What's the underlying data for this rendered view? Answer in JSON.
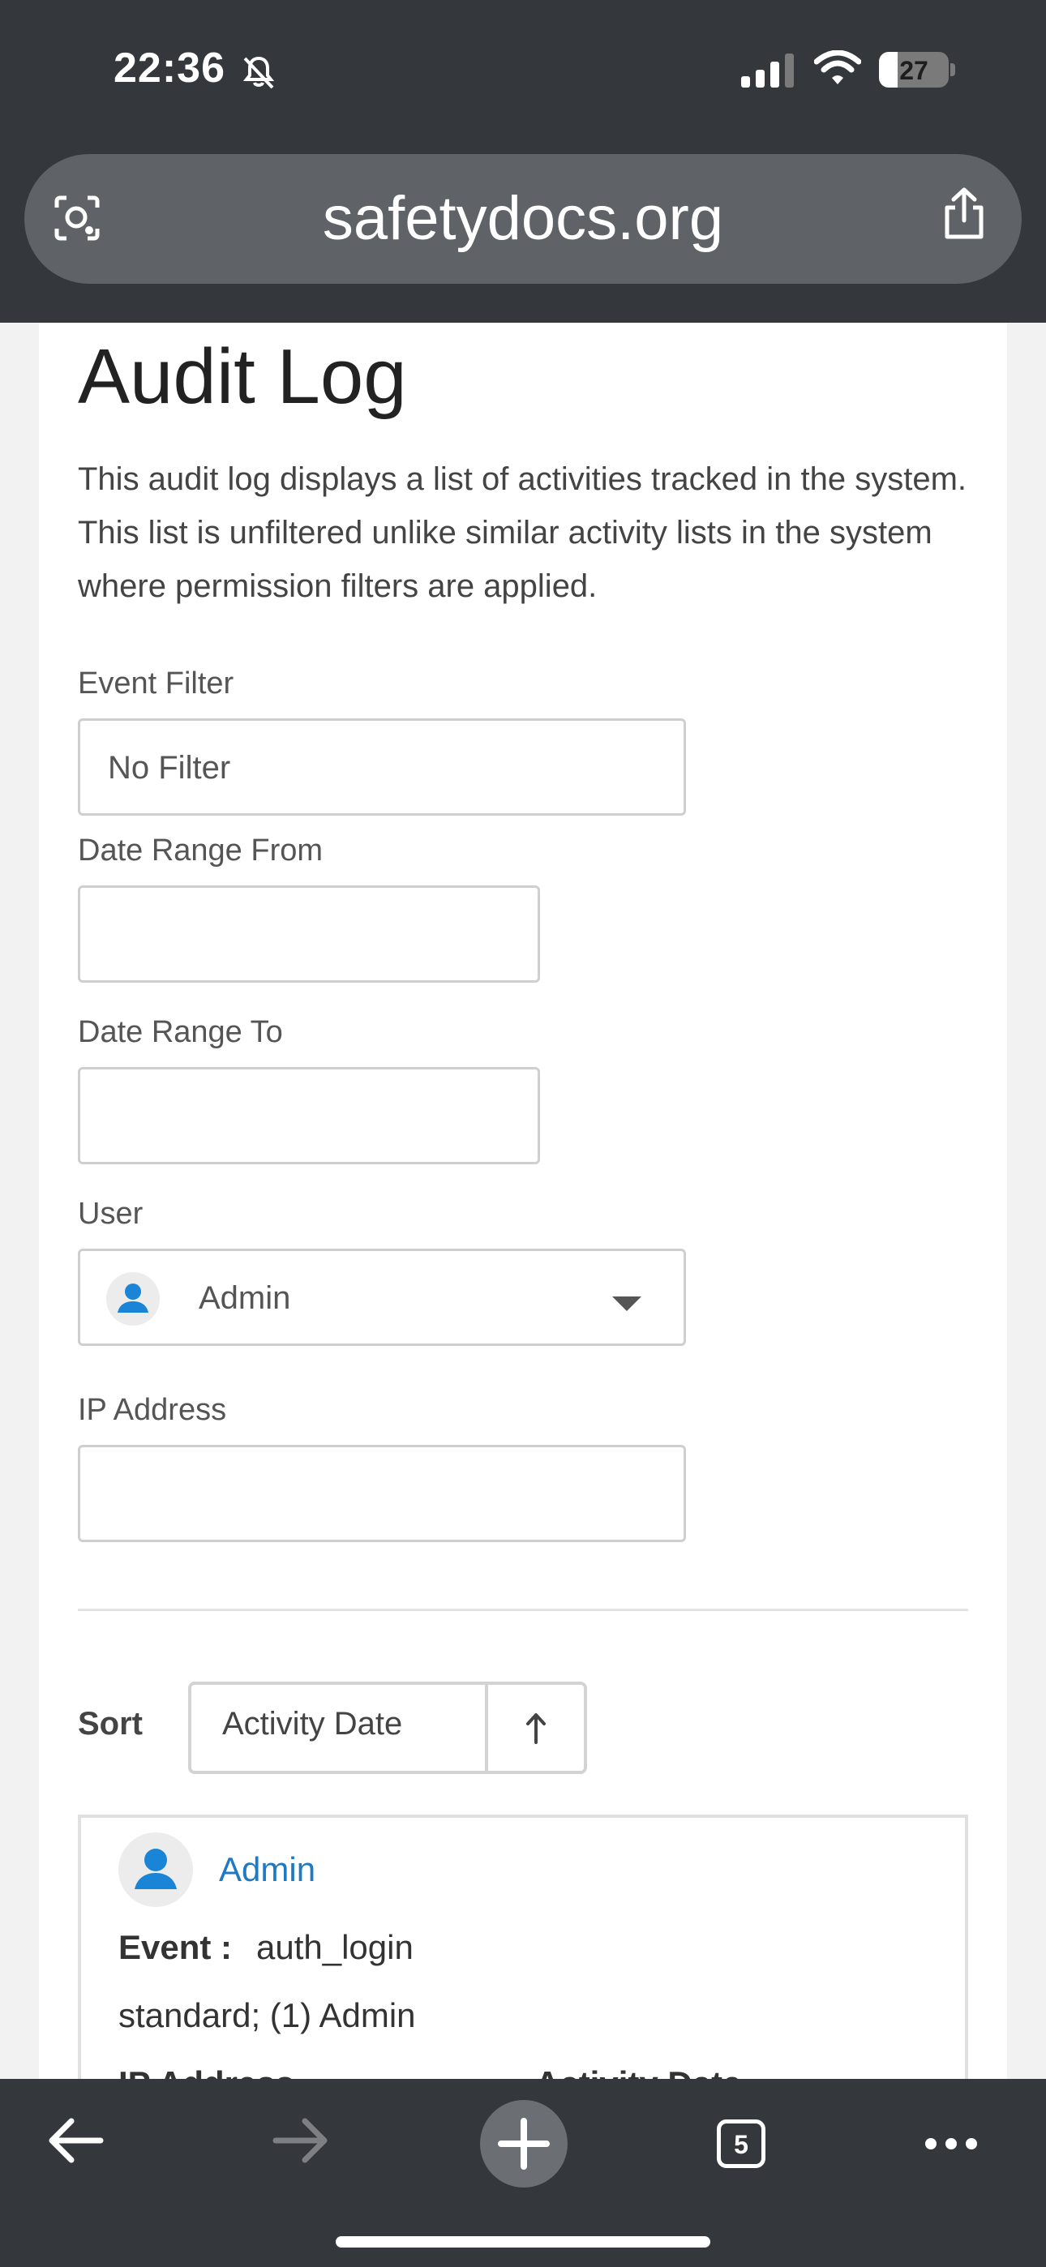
{
  "status_bar": {
    "time": "22:36",
    "battery": "27"
  },
  "browser": {
    "url": "safetydocs.org",
    "tab_count": "5"
  },
  "page": {
    "title": "Audit Log",
    "description": "This audit log displays a list of activities tracked in the system. This list is unfiltered unlike similar activity lists in the system where permission filters are applied.",
    "filters": {
      "event_filter_label": "Event Filter",
      "event_filter_value": "No Filter",
      "date_from_label": "Date Range From",
      "date_from_value": "",
      "date_to_label": "Date Range To",
      "date_to_value": "",
      "user_label": "User",
      "user_value": "Admin",
      "ip_label": "IP Address",
      "ip_value": ""
    },
    "sort": {
      "label": "Sort",
      "field": "Activity Date",
      "direction_icon": "arrow-up-icon"
    },
    "entries": [
      {
        "user": "Admin",
        "event_label": "Event :",
        "event_value": "auth_login",
        "detail": "standard; (1) Admin",
        "ip_header": "IP Address",
        "date_header": "Activity Date"
      }
    ]
  },
  "colors": {
    "chrome": "#34373b",
    "link": "#1f7ac4",
    "avatar_icon": "#1a84d6"
  }
}
